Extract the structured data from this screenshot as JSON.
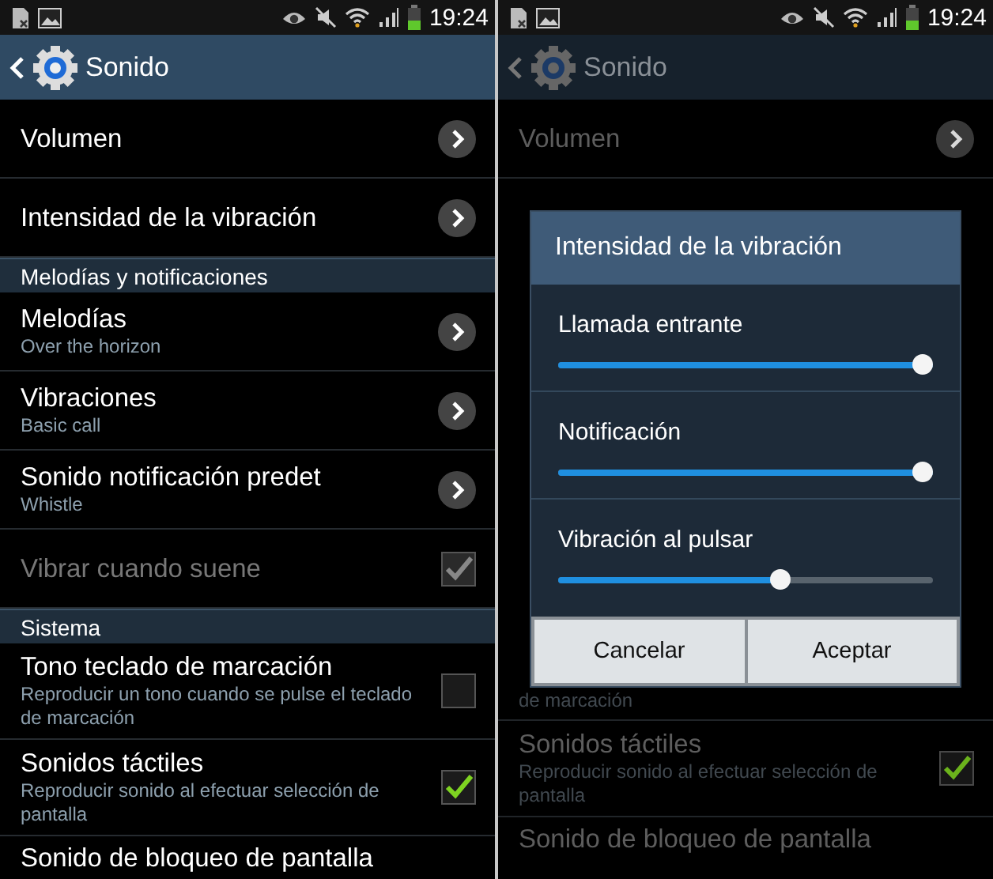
{
  "screens": [
    {
      "status_bar": {
        "time": "19:24"
      },
      "header": {
        "title": "Sonido"
      },
      "dimmed": false,
      "items": [
        {
          "kind": "link",
          "title": "Volumen"
        },
        {
          "kind": "link",
          "title": "Intensidad de la vibración"
        },
        {
          "kind": "section",
          "title": "Melodías y notificaciones"
        },
        {
          "kind": "link",
          "title": "Melodías",
          "subtitle": "Over the horizon"
        },
        {
          "kind": "link",
          "title": "Vibraciones",
          "subtitle": "Basic call"
        },
        {
          "kind": "link",
          "title": "Sonido notificación predet",
          "subtitle": "Whistle"
        },
        {
          "kind": "checkbox",
          "title": "Vibrar cuando suene",
          "checked": true,
          "disabled": true
        },
        {
          "kind": "section",
          "title": "Sistema"
        },
        {
          "kind": "checkbox",
          "title": "Tono teclado de marcación",
          "subtitle": "Reproducir un tono cuando se pulse el teclado de marcación",
          "checked": false,
          "disabled": false
        },
        {
          "kind": "checkbox",
          "title": "Sonidos táctiles",
          "subtitle": "Reproducir sonido al efectuar selección de pantalla",
          "checked": true,
          "disabled": false
        },
        {
          "kind": "partial",
          "title": "Sonido de bloqueo de pantalla"
        }
      ]
    },
    {
      "status_bar": {
        "time": "19:24"
      },
      "header": {
        "title": "Sonido"
      },
      "dimmed": true,
      "items": [
        {
          "kind": "link",
          "title": "Volumen"
        },
        {
          "kind": "dialog",
          "title": "Intensidad de la vibración",
          "sliders": [
            {
              "label": "Llamada entrante",
              "level": 1.0
            },
            {
              "label": "Notificación",
              "level": 1.0
            },
            {
              "label": "Vibración al pulsar",
              "level": 0.6
            }
          ],
          "buttons": [
            {
              "label": "Cancelar"
            },
            {
              "label": "Aceptar"
            }
          ]
        },
        {
          "kind": "fragment",
          "subtitle": "de marcación"
        },
        {
          "kind": "checkbox",
          "title": "Sonidos táctiles",
          "subtitle": "Reproducir sonido al efectuar selección de pantalla",
          "checked": true,
          "disabled": false
        },
        {
          "kind": "partial",
          "title": "Sonido de bloqueo de pantalla"
        }
      ]
    }
  ]
}
